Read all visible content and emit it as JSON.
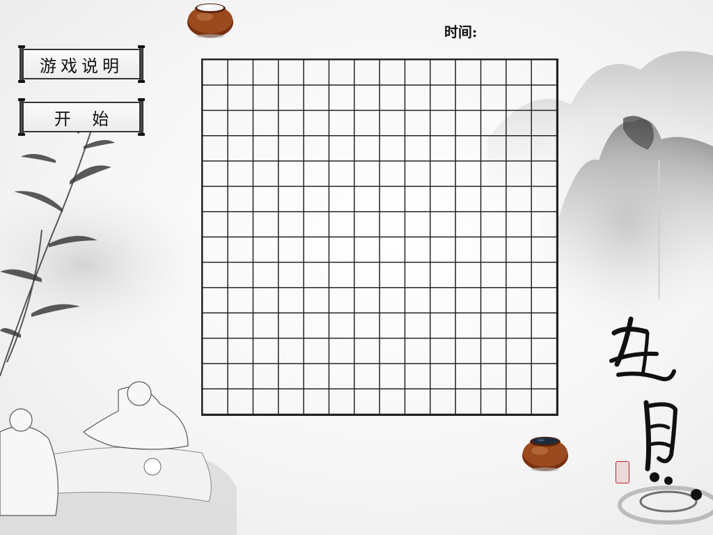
{
  "menu": {
    "rules_label": "游戏说明",
    "start_label": "开    始"
  },
  "timer": {
    "label": "时间:",
    "value": ""
  },
  "board": {
    "columns": 14,
    "rows": 14
  },
  "artwork": {
    "calligraphy_text": "五目",
    "colors": {
      "ink": "#222222",
      "bowl_wood": "#8a3a14",
      "seal": "#bb2222"
    }
  }
}
